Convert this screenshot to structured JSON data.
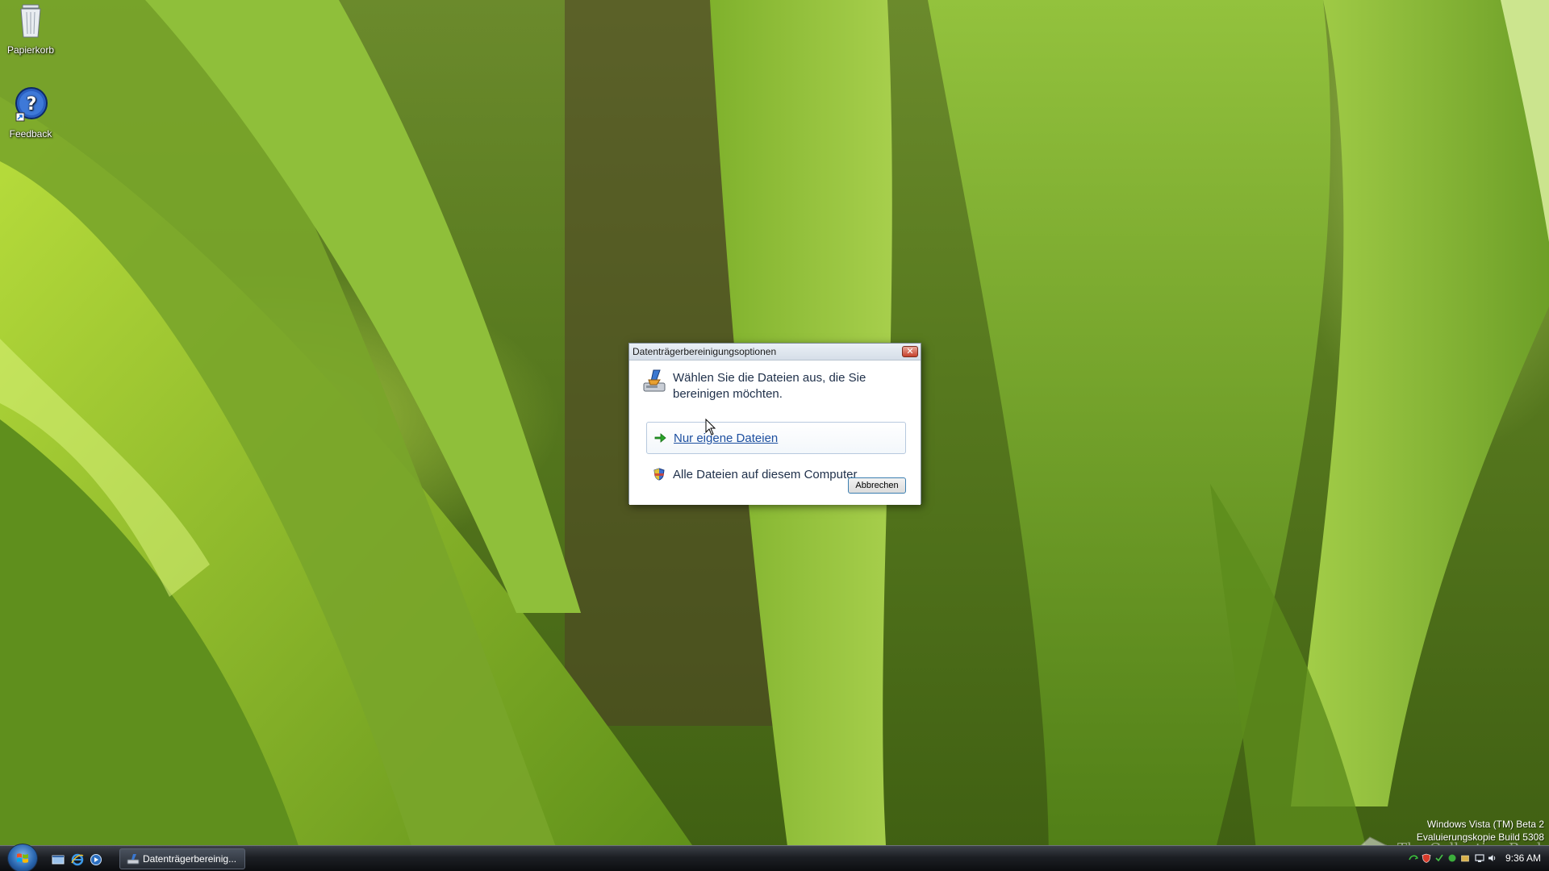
{
  "desktop": {
    "icons": [
      {
        "label": "Papierkorb",
        "icon": "recycle-bin-icon"
      },
      {
        "label": "Feedback",
        "icon": "help-feedback-icon"
      }
    ],
    "build_info": {
      "line1": "Windows Vista (TM) Beta 2",
      "line2": "Evaluierungskopie Build 5308"
    },
    "watermark": "The Collection Book"
  },
  "dialog": {
    "title": "Datenträgerbereinigungsoptionen",
    "close_glyph": "✕",
    "instruction": "Wählen Sie die Dateien aus, die Sie bereinigen möchten.",
    "options": [
      {
        "label": "Nur eigene Dateien",
        "icon": "green-arrow-icon"
      },
      {
        "label": "Alle Dateien auf diesem Computer",
        "icon": "uac-shield-icon"
      }
    ],
    "cancel_label": "Abbrechen"
  },
  "taskbar": {
    "task_button": "Datenträgerbereinig...",
    "clock": "9:36 AM",
    "quick_launch": [
      "show-desktop-icon",
      "internet-explorer-icon",
      "media-player-icon"
    ],
    "tray_icons": [
      "network-icon",
      "security-alert-icon",
      "tray-icon-3",
      "tray-icon-4",
      "tray-icon-5",
      "display-icon",
      "volume-icon"
    ]
  },
  "colors": {
    "accent_link": "#1d4fa0",
    "instruction_text": "#1e2f49",
    "close_button": "#c5402b"
  }
}
